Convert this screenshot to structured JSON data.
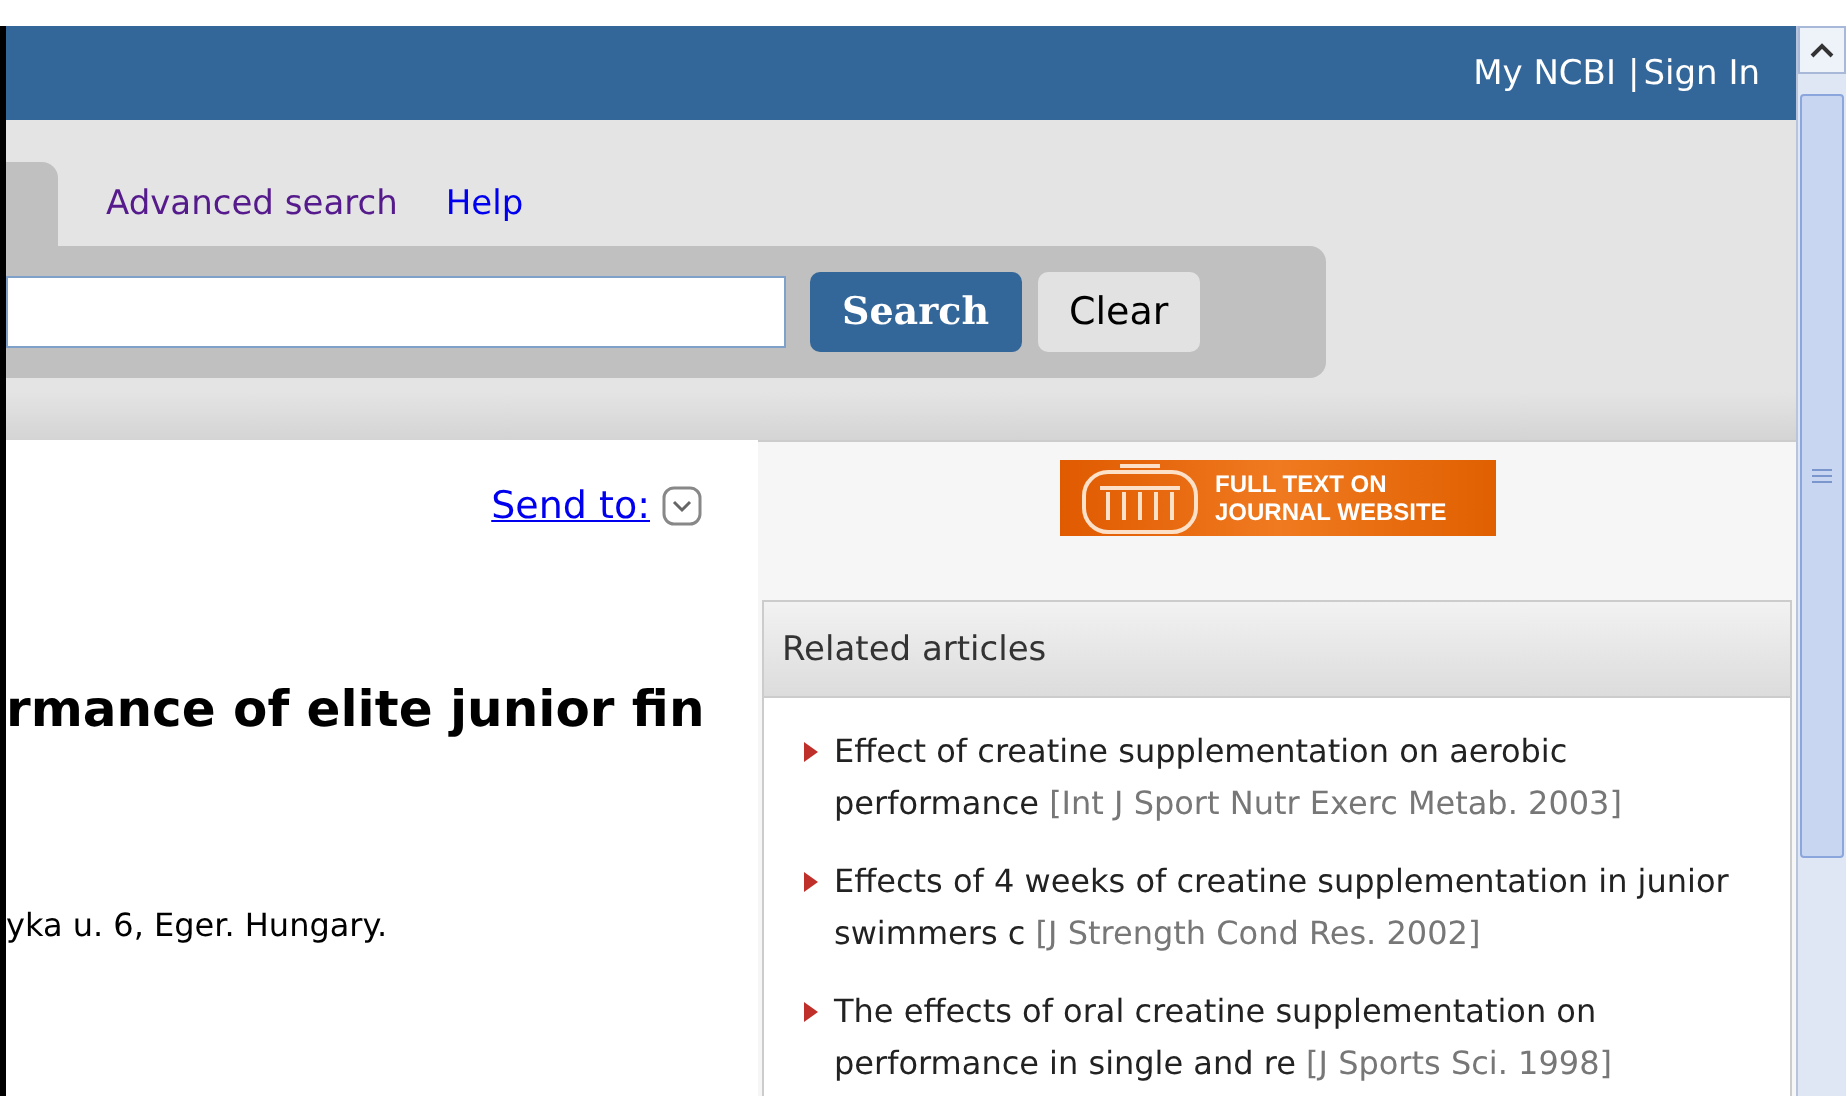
{
  "header": {
    "links": [
      {
        "label": "My NCBI"
      },
      {
        "label": "Sign In"
      }
    ],
    "separator": "|"
  },
  "search": {
    "links": [
      {
        "label": "Advanced search",
        "visited": true
      },
      {
        "label": "Help",
        "visited": false
      }
    ],
    "buttons": [
      {
        "label": "Search",
        "kind": "primary"
      },
      {
        "label": "Clear",
        "kind": "secondary"
      }
    ]
  },
  "article": {
    "send_to": "Send to:",
    "title": "rmance of elite junior fin",
    "affiliation": "yka u. 6, Eger. Hungary."
  },
  "banner": {
    "lines": [
      "FULL TEXT ON",
      "JOURNAL WEBSITE"
    ]
  },
  "related": {
    "heading": "Related articles",
    "items": [
      {
        "title": "Effect of creatine supplementation on aerobic performance",
        "source": "[Int J Sport Nutr Exerc Metab. 2003]"
      },
      {
        "title": "Effects of 4 weeks of creatine supplementation in junior swimmers c",
        "source": "[J Strength Cond Res. 2002]"
      },
      {
        "title": "The effects of oral creatine supplementation on performance in single and re",
        "source": "[J Sports Sci. 1998]"
      }
    ]
  }
}
